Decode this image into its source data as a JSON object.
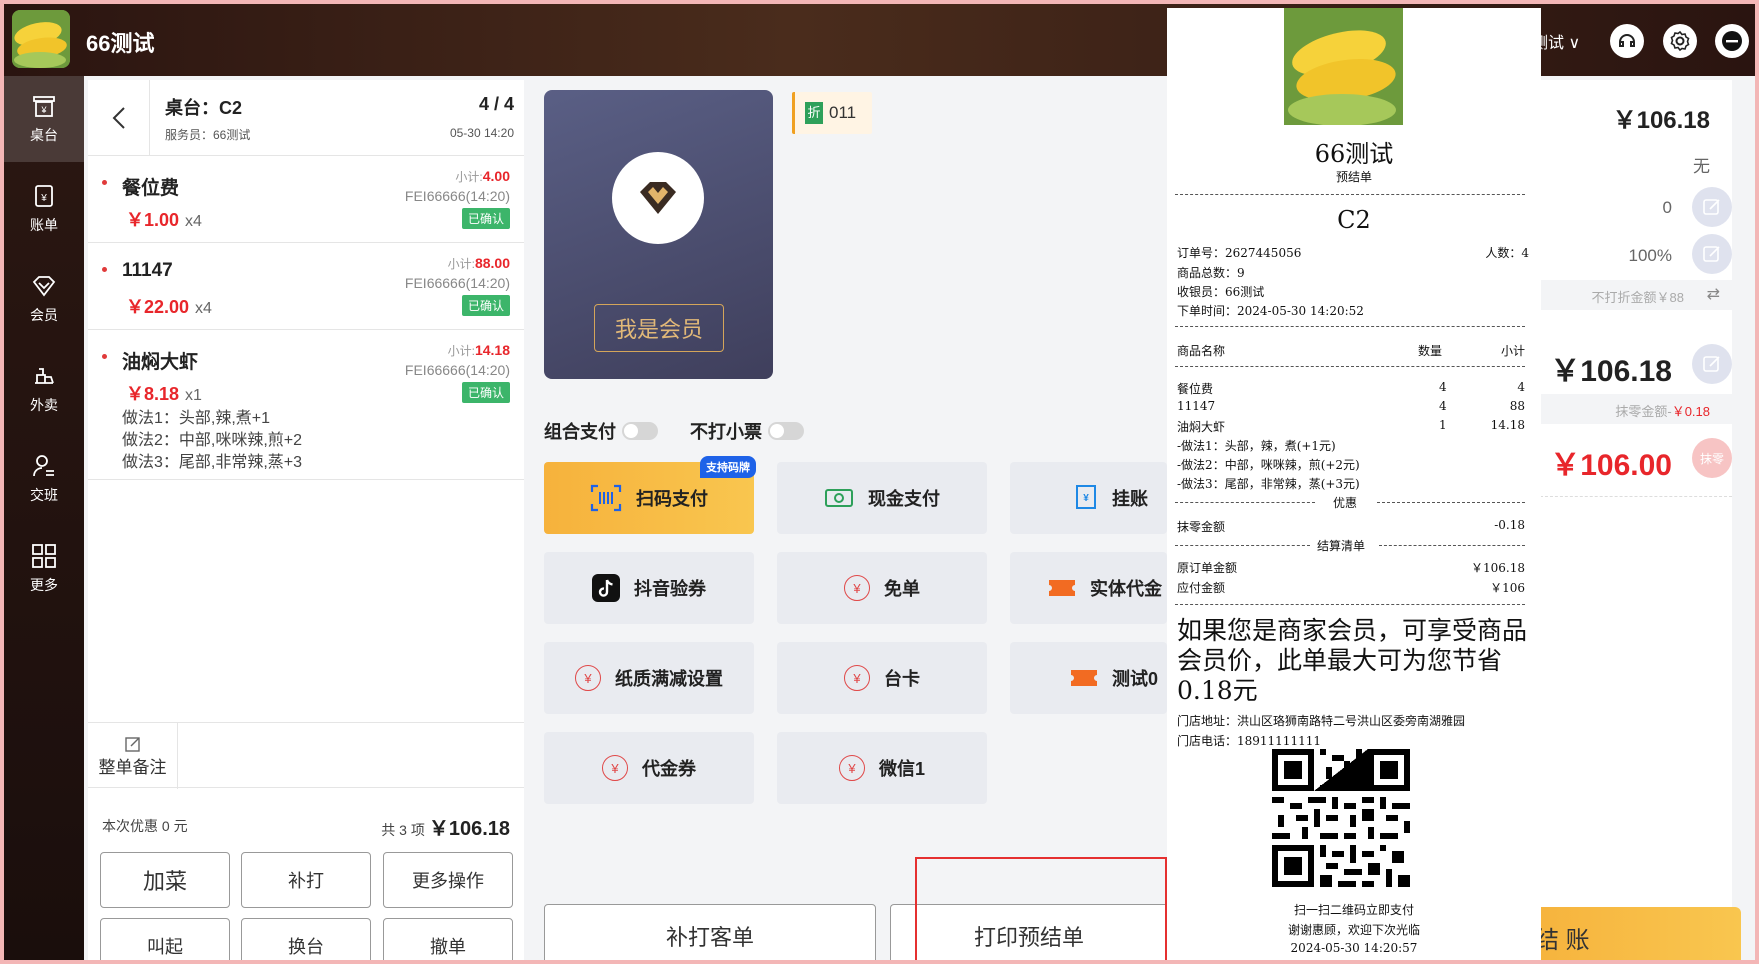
{
  "app": {
    "store_name": "66测试",
    "user_name": "测试",
    "user_chevron": "∨"
  },
  "colors": {
    "accent": "#e8262b",
    "primary_btn": "#f6b23c",
    "confirmed": "#3cb56a",
    "nav_bg": "#1a0e0c"
  },
  "topbar": {
    "icons": [
      "headset-icon",
      "settings-icon",
      "minimize-icon"
    ]
  },
  "sidenav": [
    {
      "label": "桌台",
      "icon": "table-icon",
      "active": true
    },
    {
      "label": "账单",
      "icon": "bill-icon",
      "active": false
    },
    {
      "label": "会员",
      "icon": "member-icon",
      "active": false
    },
    {
      "label": "外卖",
      "icon": "delivery-icon",
      "active": false
    },
    {
      "label": "交班",
      "icon": "shift-icon",
      "active": false
    },
    {
      "label": "更多",
      "icon": "more-icon",
      "active": false
    }
  ],
  "order": {
    "table": "桌台：C2",
    "waiter": "服务员：66测试",
    "count": "4 / 4",
    "datetime": "05-30 14:20",
    "dishes": [
      {
        "name": "餐位费",
        "price": "￥1.00",
        "qty": "x4",
        "subtotal_label": "小计:",
        "subtotal": "4.00",
        "code": "FEI66666(14:20)",
        "status": "已确认",
        "methods": []
      },
      {
        "name": "11147",
        "price": "￥22.00",
        "qty": "x4",
        "subtotal_label": "小计:",
        "subtotal": "88.00",
        "code": "FEI66666(14:20)",
        "status": "已确认",
        "methods": []
      },
      {
        "name": "油焖大虾",
        "price": "￥8.18",
        "qty": "x1",
        "subtotal_label": "小计:",
        "subtotal": "14.18",
        "code": "FEI66666(14:20)",
        "status": "已确认",
        "methods": [
          "做法1：头部,辣,煮+1",
          "做法2：中部,咪咪辣,煎+2",
          "做法3：尾部,非常辣,蒸+3"
        ]
      }
    ],
    "remark_label": "整单备注",
    "discount_text": "本次优惠 0 元",
    "total_prefix": "共 3 项",
    "total": "￥106.18",
    "actions": [
      "加菜",
      "补打",
      "更多操作",
      "叫起",
      "换台",
      "撤单"
    ]
  },
  "payment": {
    "member_button": "我是会员",
    "discount_tag_icon": "折",
    "discount_tag": "011",
    "toggle_combo": "组合支付",
    "toggle_no_ticket": "不打小票",
    "methods": [
      {
        "label": "扫码支付",
        "icon": "scan-icon",
        "badge": "支持码牌"
      },
      {
        "label": "现金支付",
        "icon": "cash-icon"
      },
      {
        "label": "挂账",
        "icon": "credit-icon"
      },
      {
        "label": "抖音验券",
        "icon": "douyin-icon"
      },
      {
        "label": "免单",
        "icon": "yen-icon"
      },
      {
        "label": "实体代金",
        "icon": "voucher-icon"
      },
      {
        "label": "纸质满减设置",
        "icon": "yen-icon"
      },
      {
        "label": "台卡",
        "icon": "yen-icon"
      },
      {
        "label": "测试0",
        "icon": "voucher-icon"
      },
      {
        "label": "代金券",
        "icon": "yen-icon"
      },
      {
        "label": "微信1",
        "icon": "yen-icon"
      }
    ],
    "reprint_customer": "补打客单",
    "print_prebill": "打印预结单",
    "yen_symbol": "¥"
  },
  "summary": {
    "amount": "￥106.18",
    "none": "无",
    "zero": "0",
    "percent": "100%",
    "no_discount": "不打折金额￥88",
    "receivable": "￥106.18",
    "rounding_label": "抹零金额-",
    "rounding_value": "￥0.18",
    "final": "￥106.00",
    "rounding_btn": "抹零",
    "checkout": "结 账"
  },
  "receipt": {
    "store": "66测试",
    "subtitle": "预结单",
    "table": "C2",
    "order_no": "订单号：2627445056",
    "people": "人数：4",
    "item_total": "商品总数：9",
    "cashier": "收银员：66测试",
    "order_time": "下单时间：2024-05-30 14:20:52",
    "col_name": "商品名称",
    "col_qty": "数量",
    "col_sub": "小计",
    "items": [
      {
        "name": "餐位费",
        "qty": "4",
        "sub": "4"
      },
      {
        "name": "11147",
        "qty": "4",
        "sub": "88"
      },
      {
        "name": "油焖大虾",
        "qty": "1",
        "sub": "14.18"
      }
    ],
    "notes": [
      "-做法1：头部，辣，煮(+1元)",
      "-做法2：中部，咪咪辣，煎(+2元)",
      "-做法3：尾部，非常辣，蒸(+3元)"
    ],
    "discount_section": "优惠",
    "rounding": "抹零金额",
    "rounding_value": "-0.18",
    "settle_section": "结算清单",
    "orig_label": "原订单金额",
    "orig_value": "￥106.18",
    "due_label": "应付金额",
    "due_value": "￥106",
    "promo": "如果您是商家会员，可享受商品会员价，此单最大可为您节省0.18元",
    "address": "门店地址：洪山区珞狮南路特二号洪山区委旁南湖雅园",
    "phone": "门店电话：18911111111",
    "scan_tip": "扫一扫二维码立即支付",
    "thanks": "谢谢惠顾，欢迎下次光临",
    "print_time": "2024-05-30 14:20:57"
  }
}
